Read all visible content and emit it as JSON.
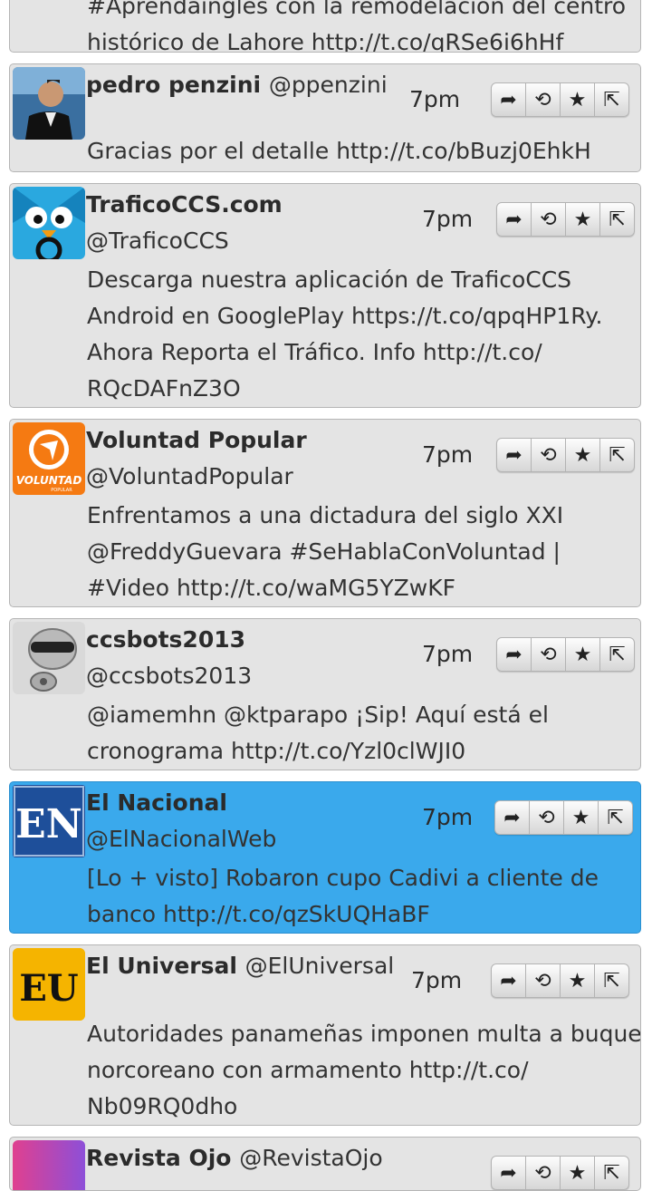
{
  "tweets": [
    {
      "text": [
        "#Aprendaingles con la remodelacion del centro",
        "histórico de Lahore http://t.co/qRSe6i6hHf"
      ]
    },
    {
      "name": "pedro penzini",
      "handle": "@ppenzini",
      "time": "7pm",
      "text": [
        "Gracias por el detalle http://t.co/bBuzj0EhkH"
      ]
    },
    {
      "name": "TraficoCCS.com",
      "handle": "@TraficoCCS",
      "time": "7pm",
      "text": [
        "Descarga nuestra aplicación de TraficoCCS",
        "Android en GooglePlay https://t.co/qpqHP1Ry.",
        "Ahora Reporta el Tráfico. Info http://t.co/",
        "RQcDAFnZ3O"
      ]
    },
    {
      "name": "Voluntad Popular",
      "handle": "@VoluntadPopular",
      "time": "7pm",
      "avatar_text": "VOLUNTAD",
      "avatar_subtext": "POPULAR",
      "text": [
        "Enfrentamos a una dictadura del siglo XXI",
        "@FreddyGuevara #SeHablaConVoluntad |",
        "#Video http://t.co/waMG5YZwKF"
      ]
    },
    {
      "name": "ccsbots2013",
      "handle": "@ccsbots2013",
      "time": "7pm",
      "text": [
        "@iamemhn @ktparapo ¡Sip! Aquí está el",
        "cronograma http://t.co/Yzl0clWJI0"
      ]
    },
    {
      "name": "El Nacional",
      "handle": "@ElNacionalWeb",
      "time": "7pm",
      "avatar_text": "EN",
      "text": [
        "[Lo + visto] Robaron cupo Cadivi a cliente de",
        "banco http://t.co/qzSkUQHaBF"
      ]
    },
    {
      "name": "El Universal",
      "handle": "@ElUniversal",
      "time": "7pm",
      "avatar_text": "EU",
      "text": [
        "Autoridades panameñas imponen multa a buque",
        "norcoreano con armamento http://t.co/",
        "Nb09RQ0dho"
      ]
    },
    {
      "name": "Revista Ojo",
      "handle": "@RevistaOjo"
    }
  ],
  "actions": {
    "reply": "reply-icon",
    "retweet": "retweet-icon",
    "favorite": "star-icon",
    "share": "share-icon"
  },
  "colors": {
    "card": "#e4e4e4",
    "selected": "#3aa9ec",
    "border": "#b5b5b5"
  }
}
